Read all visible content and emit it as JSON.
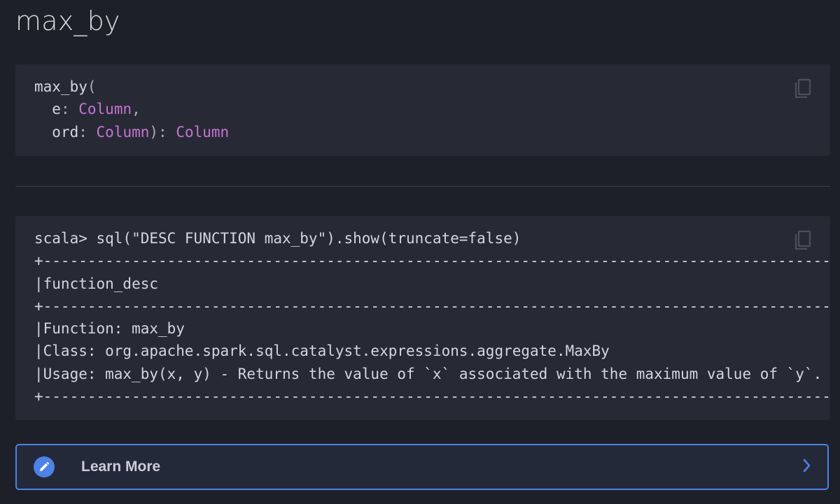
{
  "page": {
    "title": "max_by"
  },
  "signature": {
    "name": "max_by",
    "open_paren": "(",
    "params": [
      {
        "name": "e",
        "type": "Column",
        "sep": ","
      },
      {
        "name": "ord",
        "type": "Column",
        "sep": ")"
      }
    ],
    "return_sep": ": ",
    "return_type": "Column"
  },
  "output": {
    "lines": [
      "scala> sql(\"DESC FUNCTION max_by\").show(truncate=false)",
      "+------------------------------------------------------------------------------------------------",
      "|function_desc",
      "+------------------------------------------------------------------------------------------------",
      "|Function: max_by",
      "|Class: org.apache.spark.sql.catalyst.expressions.aggregate.MaxBy",
      "|Usage: max_by(x, y) - Returns the value of `x` associated with the maximum value of `y`.",
      "+------------------------------------------------------------------------------------------------"
    ]
  },
  "learn_more": {
    "label": "Learn More",
    "icon": "pencil-icon",
    "chevron": "chevron-right-icon"
  },
  "icons": {
    "copy": "copy-icon"
  },
  "colors": {
    "background": "#1e2029",
    "code_background": "#272a35",
    "type_keyword": "#c774d6",
    "accent": "#4d82e6"
  }
}
